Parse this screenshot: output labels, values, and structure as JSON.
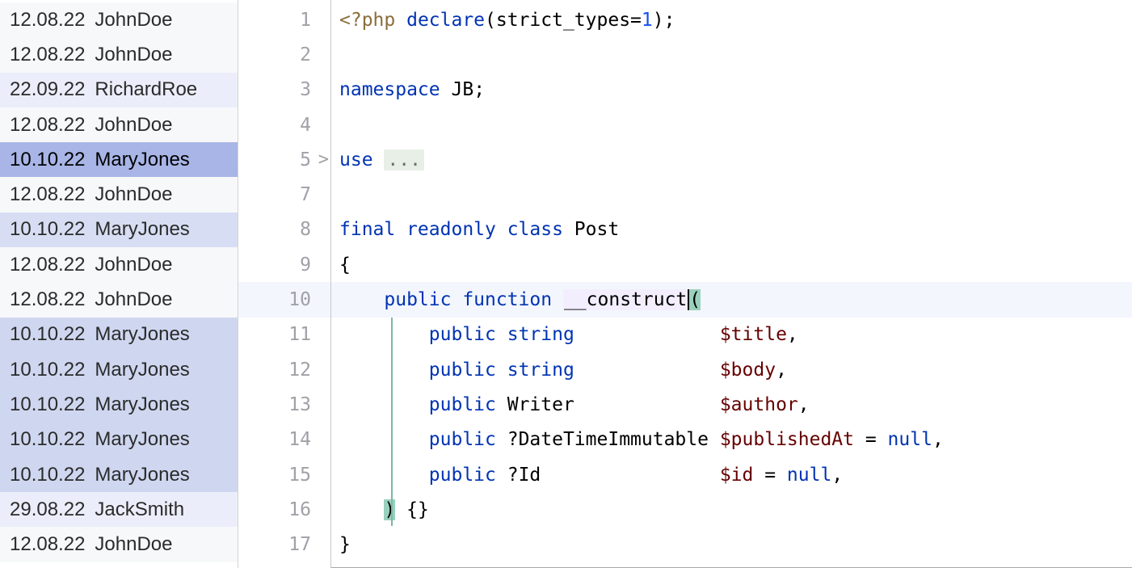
{
  "blame": [
    {
      "date": "12.08.22",
      "author": "JohnDoe",
      "cls": "bg-light1"
    },
    {
      "date": "12.08.22",
      "author": "JohnDoe",
      "cls": "bg-light1"
    },
    {
      "date": "22.09.22",
      "author": "RichardRoe",
      "cls": "bg-light2"
    },
    {
      "date": "12.08.22",
      "author": "JohnDoe",
      "cls": "bg-light1"
    },
    {
      "date": "10.10.22",
      "author": "MaryJones",
      "cls": "bg-sel"
    },
    {
      "date": "12.08.22",
      "author": "JohnDoe",
      "cls": "bg-light1"
    },
    {
      "date": "10.10.22",
      "author": "MaryJones",
      "cls": "bg-med1"
    },
    {
      "date": "12.08.22",
      "author": "JohnDoe",
      "cls": "bg-light1"
    },
    {
      "date": "12.08.22",
      "author": "JohnDoe",
      "cls": "bg-light1"
    },
    {
      "date": "10.10.22",
      "author": "MaryJones",
      "cls": "bg-med2"
    },
    {
      "date": "10.10.22",
      "author": "MaryJones",
      "cls": "bg-med2"
    },
    {
      "date": "10.10.22",
      "author": "MaryJones",
      "cls": "bg-med2"
    },
    {
      "date": "10.10.22",
      "author": "MaryJones",
      "cls": "bg-med2"
    },
    {
      "date": "10.10.22",
      "author": "MaryJones",
      "cls": "bg-med2"
    },
    {
      "date": "29.08.22",
      "author": "JackSmith",
      "cls": "bg-light2"
    },
    {
      "date": "12.08.22",
      "author": "JohnDoe",
      "cls": "bg-light1"
    }
  ],
  "line_numbers": [
    "1",
    "2",
    "3",
    "4",
    "5",
    "7",
    "8",
    "9",
    "10",
    "11",
    "12",
    "13",
    "14",
    "15",
    "16",
    "17"
  ],
  "current_line_index": 8,
  "fold_marker_index": 4,
  "fold_marker": ">",
  "code": {
    "l1": {
      "open": "<?php ",
      "kw": "declare",
      "p1": "(strict_types=",
      "num": "1",
      "p2": ");"
    },
    "l3": {
      "kw": "namespace ",
      "ns": "JB",
      "p": ";"
    },
    "l5": {
      "kw": "use ",
      "ell": "..."
    },
    "l8": {
      "kw": "final readonly class ",
      "cls": "Post"
    },
    "l9": "{",
    "l10": {
      "indent": "    ",
      "kw": "public function ",
      "name": "__construct",
      "paren": "("
    },
    "params": [
      {
        "kw": "public ",
        "type": "string",
        "typecls": "kw",
        "pad": "             ",
        "var": "$title",
        "tail": ","
      },
      {
        "kw": "public ",
        "type": "string",
        "typecls": "kw",
        "pad": "             ",
        "var": "$body",
        "tail": ","
      },
      {
        "kw": "public ",
        "type": "Writer",
        "typecls": "cls",
        "pad": "             ",
        "var": "$author",
        "tail": ","
      },
      {
        "kw": "public ",
        "type": "?DateTimeImmutable",
        "typecls": "cls",
        "pad": " ",
        "var": "$publishedAt",
        "tail": " = ",
        "nul": "null",
        "tail2": ","
      },
      {
        "kw": "public ",
        "type": "?Id",
        "typecls": "cls",
        "pad": "                ",
        "var": "$id",
        "tail": " = ",
        "nul": "null",
        "tail2": ","
      }
    ],
    "l16": {
      "indent": "    ",
      "close": ")",
      "body": " {}"
    },
    "l17": "}"
  }
}
